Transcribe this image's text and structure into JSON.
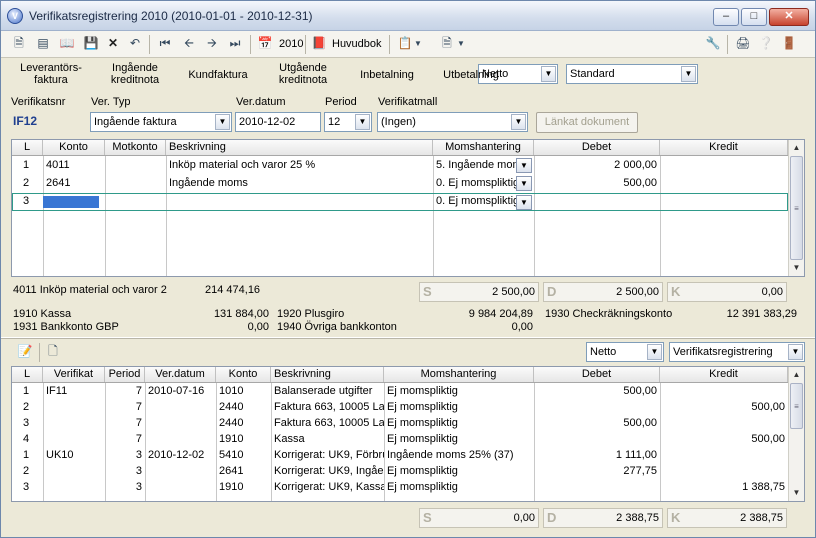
{
  "window": {
    "title": "Verifikatsregistrering 2010 (2010-01-01 - 2010-12-31)"
  },
  "toolbar": {
    "year_label": "2010",
    "huvudbok_label": "Huvudbok",
    "view_combo": "Netto",
    "layout_combo": "Standard"
  },
  "ribbon": {
    "tabs": [
      {
        "line1": "Leverantörs-",
        "line2": "faktura"
      },
      {
        "line1": "Ingående",
        "line2": "kreditnota"
      },
      {
        "line1": "Kundfaktura",
        "line2": ""
      },
      {
        "line1": "Utgående",
        "line2": "kreditnota"
      },
      {
        "line1": "Inbetalning",
        "line2": ""
      },
      {
        "line1": "Utbetalning",
        "line2": ""
      }
    ]
  },
  "form": {
    "verifikatsnr_label": "Verifikatsnr",
    "vertyp_label": "Ver. Typ",
    "verdatum_label": "Ver.datum",
    "period_label": "Period",
    "mall_label": "Verifikatmall",
    "verifikatsnr": "IF12",
    "vertyp": "Ingående faktura",
    "verdatum": "2010-12-02",
    "period": "12",
    "mall": "(Ingen)",
    "linked_doc_label": "Länkat dokument"
  },
  "entry_grid": {
    "headers": [
      "L",
      "Konto",
      "Motkonto",
      "Beskrivning",
      "Momshantering",
      "Debet",
      "Kredit"
    ],
    "rows": [
      {
        "l": "1",
        "konto": "4011",
        "motkonto": "",
        "beskrivning": "Inköp material och varor 25 %",
        "moms": "5. Ingående mom",
        "debet": "2 000,00",
        "kredit": ""
      },
      {
        "l": "2",
        "konto": "2641",
        "motkonto": "",
        "beskrivning": "Ingående moms",
        "moms": "0. Ej momspliktig",
        "debet": "500,00",
        "kredit": ""
      },
      {
        "l": "3",
        "konto": "",
        "motkonto": "",
        "beskrivning": "",
        "moms": "0. Ej momspliktig",
        "debet": "",
        "kredit": ""
      }
    ]
  },
  "summary": {
    "account_text": "4011 Inköp material och varor 2",
    "account_balance": "214 474,16",
    "s_label": "S",
    "s_value": "2 500,00",
    "d_label": "D",
    "d_value": "2 500,00",
    "k_label": "K",
    "k_value": "0,00",
    "balances": [
      {
        "name": "1910 Kassa",
        "value": "131 884,00"
      },
      {
        "name": "1920 Plusgiro",
        "value": "9 984 204,89"
      },
      {
        "name": "1930 Checkräkningskonto",
        "value": "12 391 383,29"
      },
      {
        "name": "1931 Bankkonto GBP",
        "value": "0,00"
      },
      {
        "name": "1940 Övriga bankkonton",
        "value": "0,00"
      }
    ]
  },
  "lower_toolbar": {
    "view_combo": "Netto",
    "source_combo": "Verifikatsregistrering"
  },
  "history_grid": {
    "headers": [
      "L",
      "Verifikat",
      "Period",
      "Ver.datum",
      "Konto",
      "Beskrivning",
      "Momshantering",
      "Debet",
      "Kredit"
    ],
    "rows": [
      {
        "l": "1",
        "verifikat": "IF11",
        "period": "7",
        "datum": "2010-07-16",
        "konto": "1010",
        "beskrivning": "Balanserade utgifter",
        "moms": "Ej momspliktig",
        "debet": "500,00",
        "kredit": ""
      },
      {
        "l": "2",
        "verifikat": "",
        "period": "7",
        "datum": "",
        "konto": "2440",
        "beskrivning": "Faktura 663, 10005 La",
        "moms": "Ej momspliktig",
        "debet": "",
        "kredit": "500,00"
      },
      {
        "l": "3",
        "verifikat": "",
        "period": "7",
        "datum": "",
        "konto": "2440",
        "beskrivning": "Faktura 663, 10005 La",
        "moms": "Ej momspliktig",
        "debet": "500,00",
        "kredit": ""
      },
      {
        "l": "4",
        "verifikat": "",
        "period": "7",
        "datum": "",
        "konto": "1910",
        "beskrivning": "Kassa",
        "moms": "Ej momspliktig",
        "debet": "",
        "kredit": "500,00"
      },
      {
        "l": "1",
        "verifikat": "UK10",
        "period": "3",
        "datum": "2010-12-02",
        "konto": "5410",
        "beskrivning": "Korrigerat: UK9, Förbru",
        "moms": "Ingående moms 25% (37)",
        "debet": "1 111,00",
        "kredit": ""
      },
      {
        "l": "2",
        "verifikat": "",
        "period": "3",
        "datum": "",
        "konto": "2641",
        "beskrivning": "Korrigerat: UK9, Ingåer",
        "moms": "Ej momspliktig",
        "debet": "277,75",
        "kredit": ""
      },
      {
        "l": "3",
        "verifikat": "",
        "period": "3",
        "datum": "",
        "konto": "1910",
        "beskrivning": "Korrigerat: UK9, Kassa",
        "moms": "Ej momspliktig",
        "debet": "",
        "kredit": "1 388,75"
      }
    ]
  },
  "bottom_summary": {
    "s_label": "S",
    "s_value": "0,00",
    "d_label": "D",
    "d_value": "2 388,75",
    "k_label": "K",
    "k_value": "2 388,75"
  }
}
